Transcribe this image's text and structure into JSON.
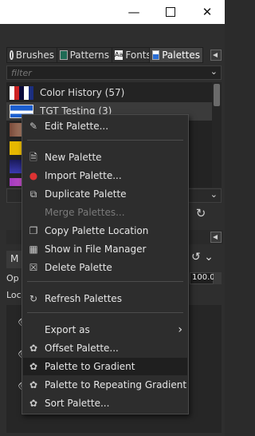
{
  "window": {
    "minimize_icon": "minimize-icon",
    "maximize_icon": "maximize-icon",
    "close_icon": "close-icon"
  },
  "tabs": [
    {
      "label": "Brushes",
      "icon": "brushes-icon"
    },
    {
      "label": "Patterns",
      "icon": "patterns-icon"
    },
    {
      "label": "Fonts",
      "icon": "fonts-icon"
    },
    {
      "label": "Palettes",
      "icon": "palettes-icon",
      "active": true
    }
  ],
  "filter": {
    "placeholder": "filter"
  },
  "palettes": [
    {
      "label": "Color History (57)"
    },
    {
      "label": "TGT Testing (3)",
      "selected": true
    }
  ],
  "context_menu": {
    "items": [
      {
        "label": "Edit Palette...",
        "icon": "edit-icon"
      },
      {
        "label": "New Palette",
        "icon": "new-icon"
      },
      {
        "label": "Import Palette...",
        "icon": "import-icon"
      },
      {
        "label": "Duplicate Palette",
        "icon": "duplicate-icon"
      },
      {
        "label": "Merge Palettes...",
        "icon": "merge-icon",
        "disabled": true
      },
      {
        "label": "Copy Palette Location",
        "icon": "copy-icon"
      },
      {
        "label": "Show in File Manager",
        "icon": "folder-icon"
      },
      {
        "label": "Delete Palette",
        "icon": "delete-icon"
      },
      {
        "label": "Refresh Palettes",
        "icon": "refresh-icon"
      },
      {
        "label": "Export as",
        "icon": "",
        "submenu": true
      },
      {
        "label": "Offset Palette...",
        "icon": "plugin-icon"
      },
      {
        "label": "Palette to Gradient",
        "icon": "plugin-icon",
        "hover": true
      },
      {
        "label": "Palette to Repeating Gradient",
        "icon": "plugin-icon"
      },
      {
        "label": "Sort Palette...",
        "icon": "plugin-icon"
      }
    ]
  },
  "layers": {
    "mode_label": "M",
    "opacity_label": "Op",
    "opacity_value": "100.0",
    "lock_label": "Loc"
  },
  "colors": {
    "menu_bg": "#2d2d2d",
    "hover_bg": "#1f1f1f",
    "dock_bg": "#2e2e2e"
  }
}
